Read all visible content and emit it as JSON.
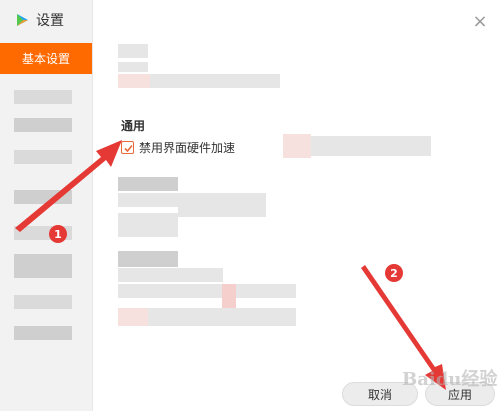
{
  "window": {
    "title": "设置",
    "close_glyph": "×"
  },
  "sidebar": {
    "active_item": "基本设置"
  },
  "main": {
    "section_title": "通用",
    "checkbox": {
      "label": "禁用界面硬件加速",
      "checked": true
    }
  },
  "footer": {
    "cancel_label": "取消",
    "apply_label": "应用"
  },
  "annotations": {
    "badge_1": "1",
    "badge_2": "2",
    "arrow_color": "#e53935"
  },
  "watermark": "Baidu经验",
  "colors": {
    "accent": "#ff6a00",
    "checkbox_border": "#e86a3b",
    "sidebar_bg": "#f2f2f2"
  }
}
